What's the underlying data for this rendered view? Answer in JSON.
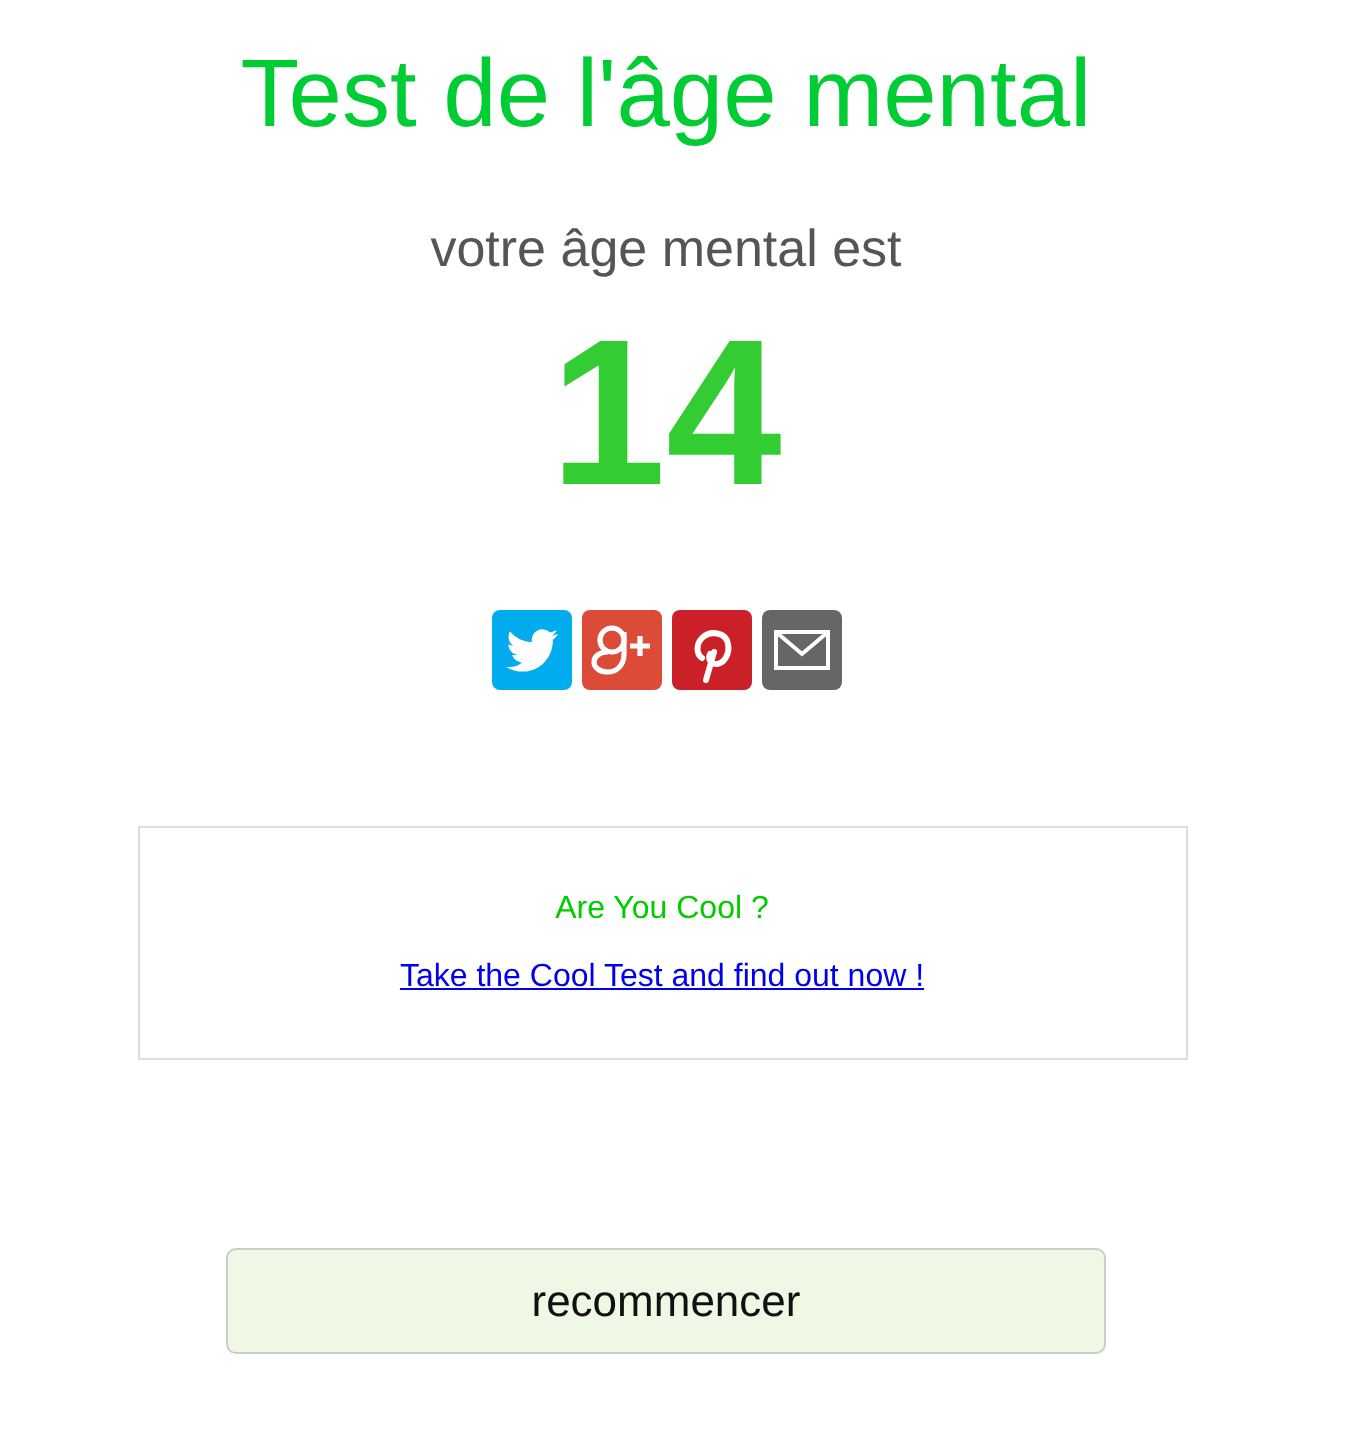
{
  "title": "Test de l'âge mental",
  "subtitle": "votre âge mental est",
  "result": "14",
  "share_buttons": [
    {
      "kind": "twitter"
    },
    {
      "kind": "googleplus"
    },
    {
      "kind": "pinterest"
    },
    {
      "kind": "email"
    }
  ],
  "promo": {
    "heading": "Are You Cool ?",
    "link": "Take the Cool Test and find out now !"
  },
  "restart_button": "recommencer"
}
